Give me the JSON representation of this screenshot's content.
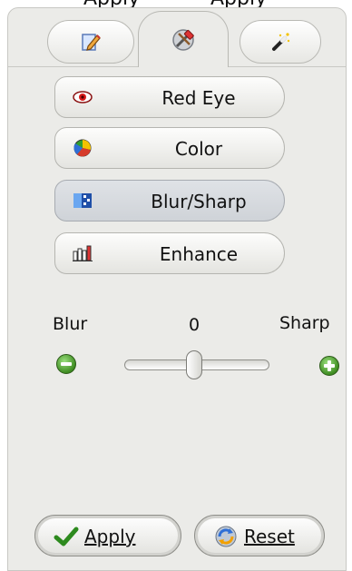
{
  "top_fragments": [
    "Apply",
    "Apply"
  ],
  "tabs": [
    {
      "name": "edit",
      "icon": "pencil-document-icon",
      "active": false
    },
    {
      "name": "tools",
      "icon": "hammer-wrench-icon",
      "active": true
    },
    {
      "name": "effects",
      "icon": "magic-wand-icon",
      "active": false
    }
  ],
  "tools": [
    {
      "label": "Red Eye",
      "icon": "red-eye-icon",
      "selected": false
    },
    {
      "label": "Color",
      "icon": "color-wheel-icon",
      "selected": false
    },
    {
      "label": "Blur/Sharp",
      "icon": "blur-sharp-icon",
      "selected": true
    },
    {
      "label": "Enhance",
      "icon": "enhance-bars-icon",
      "selected": false
    }
  ],
  "slider": {
    "left_label": "Blur",
    "right_label": "Sharp",
    "value": "0",
    "minus_icon": "minus-circle-icon",
    "plus_icon": "plus-circle-icon"
  },
  "actions": {
    "apply": {
      "label": "Apply",
      "icon": "checkmark-icon"
    },
    "reset": {
      "label": "Reset",
      "icon": "reset-arrows-icon"
    }
  },
  "colors": {
    "panel": "#ebebe8",
    "selected_button": "#d4d8dd",
    "accent_green": "#3f8d22"
  }
}
